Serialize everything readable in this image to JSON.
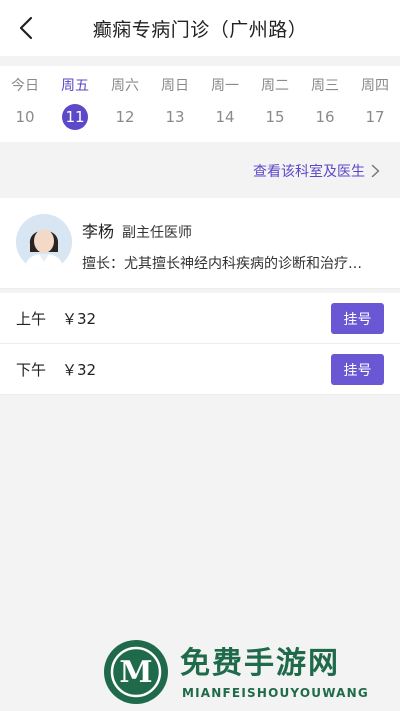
{
  "header": {
    "title": "癫痫专病门诊（广州路）",
    "back_icon": "chevron-left-icon"
  },
  "week": {
    "days": [
      {
        "name": "今日",
        "date": "10",
        "selected": false
      },
      {
        "name": "周五",
        "date": "11",
        "selected": true
      },
      {
        "name": "周六",
        "date": "12",
        "selected": false
      },
      {
        "name": "周日",
        "date": "13",
        "selected": false
      },
      {
        "name": "周一",
        "date": "14",
        "selected": false
      },
      {
        "name": "周二",
        "date": "15",
        "selected": false
      },
      {
        "name": "周三",
        "date": "16",
        "selected": false
      },
      {
        "name": "周四",
        "date": "17",
        "selected": false
      }
    ]
  },
  "link": {
    "label": "查看该科室及医生",
    "icon": "chevron-right-icon"
  },
  "doctor": {
    "name": "李杨",
    "title": "副主任医师",
    "specialty": "擅长：尤其擅长神经内科疾病的诊断和治疗…"
  },
  "slots": [
    {
      "period": "上午",
      "price": "￥32",
      "button": "挂号"
    },
    {
      "period": "下午",
      "price": "￥32",
      "button": "挂号"
    }
  ],
  "watermark": {
    "title": "免费手游网",
    "subtitle": "MIANFEISHOUYOUWANG",
    "logo_letter": "M"
  },
  "colors": {
    "accent": "#5b49c9",
    "button": "#6a57d4",
    "background": "#f3f3f3",
    "watermark": "#1f6a4a"
  }
}
